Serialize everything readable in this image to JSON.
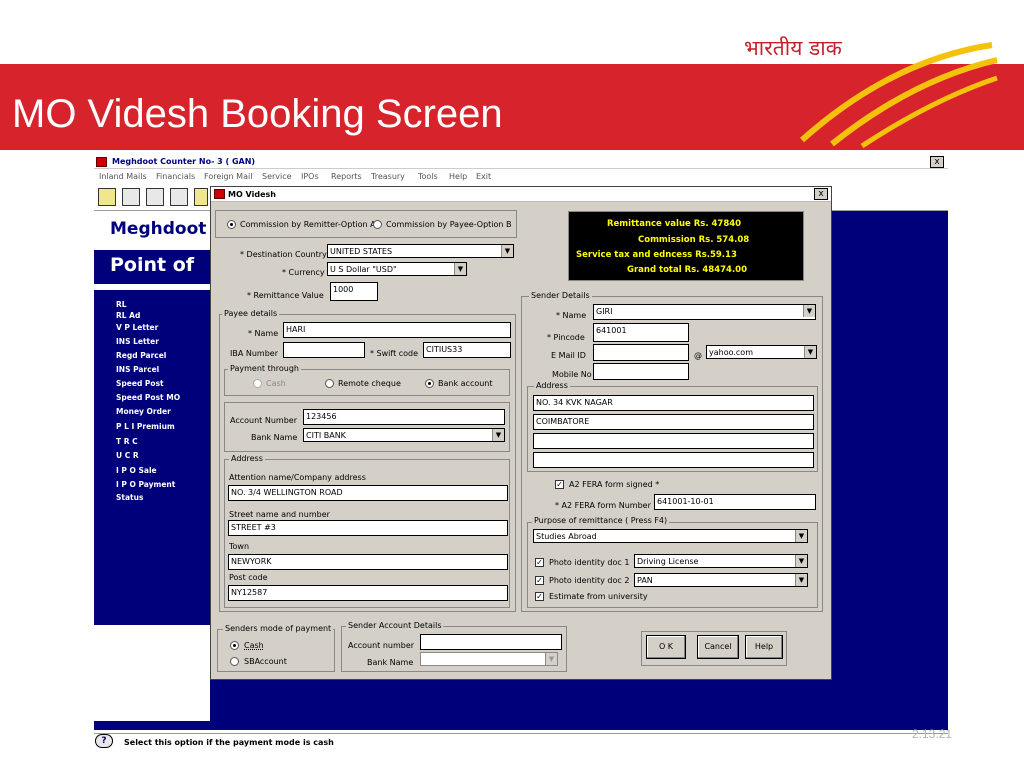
{
  "slide": {
    "title": "MO Videsh Booking Screen",
    "logo_text": "भारतीय डाक",
    "slide_number": "2.13.21",
    "band_color": "#d7232c"
  },
  "app": {
    "window_title": "Meghdoot   Counter No- 3 ( GAN)",
    "close_label": "x",
    "menu": [
      "Inland Mails",
      "Financials",
      "Foreign Mail",
      "Service",
      "IPOs",
      "Reports",
      "Treasury",
      "Tools",
      "Help",
      "Exit"
    ],
    "brand_label": "Meghdoot",
    "pof_label": "Point of",
    "sidebar_items": [
      "RL",
      "RL Ad",
      "V P Letter",
      "INS Letter",
      "Regd Parcel",
      "INS Parcel",
      "Speed Post",
      "Speed Post MO",
      "Money Order",
      "P L I Premium",
      "T R C",
      "U C R",
      "I P O Sale",
      "I P O Payment",
      "Status"
    ],
    "status_text": "Select this option if the payment mode is cash",
    "help_icon_glyph": "?"
  },
  "dialog": {
    "title": "MO Videsh",
    "close_label": "x",
    "commission": {
      "option_a": "Commission by Remitter-Option A",
      "option_b": "Commission by Payee-Option B"
    },
    "destination": {
      "label": "* Destination Country",
      "value": "UNITED STATES"
    },
    "currency": {
      "label": "* Currency",
      "value": "U S Dollar \"USD\""
    },
    "remit_value": {
      "label": "* Remittance Value",
      "value": "1000"
    },
    "summary": {
      "remittance": "Remittance value Rs.  47840",
      "commission": "Commission Rs. 574.08",
      "tax": "Service tax and edncess Rs.59.13",
      "total": "Grand total Rs. 48474.00"
    },
    "payee": {
      "group_label": "Payee details",
      "name_label": "* Name",
      "name_value": "HARI",
      "iba_label": "IBA Number",
      "iba_value": "",
      "swift_label": "* Swift code",
      "swift_value": "CITIUS33",
      "payment_through_label": "Payment through",
      "pay_cash": "Cash",
      "pay_remote": "Remote cheque",
      "pay_bank": "Bank account",
      "account_label": "Account Number",
      "account_value": "123456",
      "bank_label": "Bank Name",
      "bank_value": "CITI BANK",
      "address_label": "Address",
      "attention_label": "Attention name/Company address",
      "attention_value": "NO. 3/4 WELLINGTON ROAD",
      "street_label": "Street name and number",
      "street_value": "STREET #3",
      "town_label": "Town",
      "town_value": "NEWYORK",
      "postcode_label": "Post code",
      "postcode_value": "NY12587"
    },
    "sender": {
      "group_label": "Sender Details",
      "name_label": "* Name",
      "name_value": "GIRI",
      "pincode_label": "* Pincode",
      "pincode_value": "641001",
      "email_label": "E Mail ID",
      "email_value": "",
      "email_at": "@",
      "email_domain": "yahoo.com",
      "mobile_label": "Mobile No",
      "mobile_value": "",
      "address_label": "Address",
      "address_lines": [
        "NO. 34 KVK NAGAR",
        "COIMBATORE",
        "",
        ""
      ],
      "fera_signed_label": "A2 FERA form signed *",
      "fera_number_label": "* A2 FERA form Number",
      "fera_number_value": "641001-10-01",
      "purpose_label": "Purpose of remittance ( Press F4)",
      "purpose_value": "Studies Abroad",
      "photo1_label": "Photo identity doc 1",
      "photo1_value": "Driving License",
      "photo2_label": "Photo identity doc 2",
      "photo2_value": "PAN",
      "estimate_label": "Estimate from university"
    },
    "senders_mode": {
      "group_label": "Senders mode of payment",
      "cash": "Cash",
      "sbaccount": "SBAccount"
    },
    "sender_account": {
      "group_label": "Sender Account Details",
      "account_label": "Account number",
      "account_value": "",
      "bank_label": "Bank Name",
      "bank_value": ""
    },
    "buttons": {
      "ok": "O K",
      "cancel": "Cancel",
      "help": "Help"
    }
  }
}
